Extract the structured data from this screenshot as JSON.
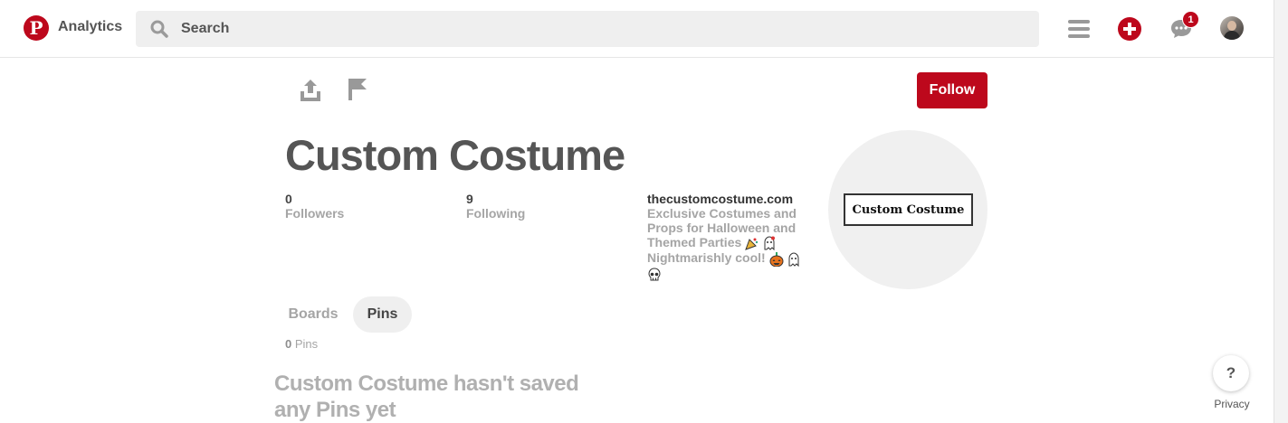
{
  "header": {
    "logo_letter": "P",
    "analytics_label": "Analytics",
    "search_placeholder": "Search",
    "notification_count": "1",
    "brand_color": "#bd081c"
  },
  "toolbar": {
    "follow_label": "Follow"
  },
  "profile": {
    "name": "Custom Costume",
    "followers_count": "0",
    "followers_label": "Followers",
    "following_count": "9",
    "following_label": "Following",
    "website": "thecustomcostume.com",
    "bio": "Exclusive Costumes and Props for Halloween and Themed Parties",
    "bio_tagline": "Nightmarishly cool!",
    "bio_emoji": [
      "party-popper-icon",
      "ghost-icon",
      "jack-o-lantern-icon",
      "ghost-icon",
      "skull-icon"
    ],
    "logo_text": "Custom Costume"
  },
  "tabs": [
    {
      "label": "Boards",
      "active": false
    },
    {
      "label": "Pins",
      "active": true
    }
  ],
  "pins": {
    "count": "0",
    "count_label": "Pins",
    "empty_message": "Custom Costume hasn't saved any Pins yet"
  },
  "footer": {
    "help_label": "?",
    "privacy_label": "Privacy"
  }
}
